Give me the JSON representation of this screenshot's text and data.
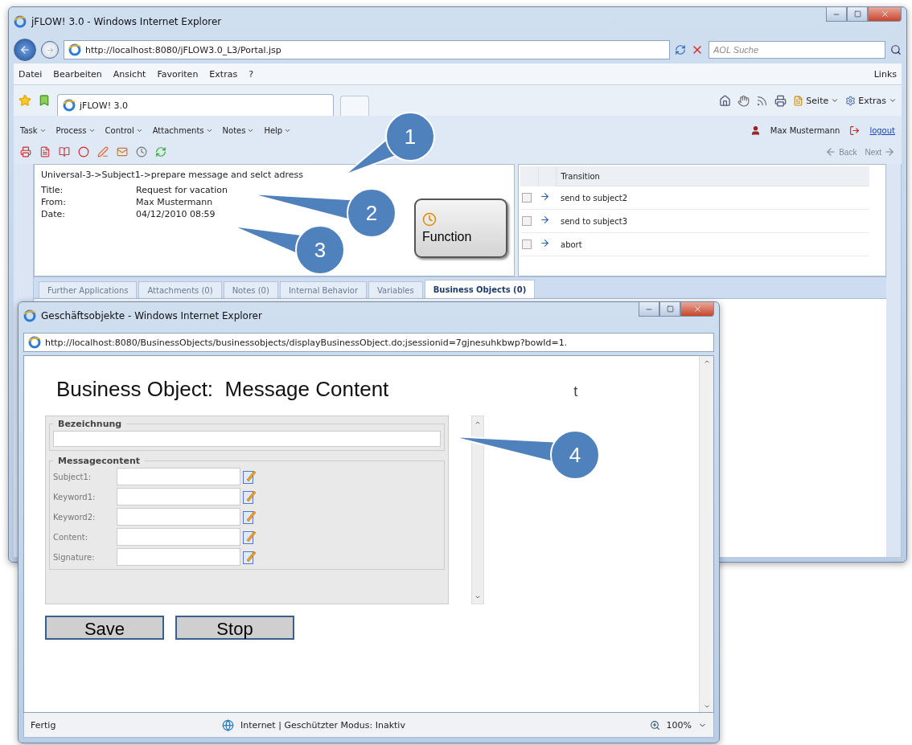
{
  "main_window": {
    "title": "jFLOW! 3.0 - Windows Internet Explorer",
    "address": "http://localhost:8080/jFLOW3.0_L3/Portal.jsp",
    "search": {
      "placeholder": "AOL Suche"
    },
    "menu": [
      "Datei",
      "Bearbeiten",
      "Ansicht",
      "Favoriten",
      "Extras",
      "?"
    ],
    "links": "Links",
    "tab": "jFLOW! 3.0",
    "command_bar": [
      "Seite",
      "Extras"
    ]
  },
  "app": {
    "menu": [
      "Task",
      "Process",
      "Control",
      "Attachments",
      "Notes",
      "Help"
    ],
    "user": "Max Mustermann",
    "logout": "logout",
    "nav": [
      {
        "label": "Back",
        "disabled": true
      },
      {
        "label": "Next",
        "disabled": true
      }
    ],
    "path": "Universal-3->Subject1->prepare message and selct adress",
    "fields": [
      {
        "label": "Title:",
        "value": "Request for vacation"
      },
      {
        "label": "From:",
        "value": "Max Mustermann"
      },
      {
        "label": "Date:",
        "value": "04/12/2010 08:59"
      }
    ],
    "function_button": "Function",
    "transition_table": {
      "columns": [
        "Transition"
      ],
      "rows": [
        {
          "label": "send to subject2",
          "checked": false
        },
        {
          "label": "send to subject3",
          "checked": false
        },
        {
          "label": "abort",
          "checked": false
        }
      ]
    },
    "tabs": [
      {
        "label": "Further Applications",
        "selected": false
      },
      {
        "label": "Attachments (0)",
        "selected": false
      },
      {
        "label": "Notes (0)",
        "selected": false
      },
      {
        "label": "Internal Behavior",
        "selected": false
      },
      {
        "label": "Variables",
        "selected": false
      },
      {
        "label": "Business Objects (0)",
        "selected": true
      }
    ]
  },
  "popup": {
    "title": "Geschäftsobjekte - Windows Internet Explorer",
    "address": "http://localhost:8080/BusinessObjects/businessobjects/displayBusinessObject.do;jsessionid=7gjnesuhkbwp?bowId=1.",
    "heading": "Business Object:  Message Content",
    "stray_text": "t",
    "name_fieldset": {
      "legend": "Bezeichnung"
    },
    "content_fieldset": {
      "legend": "Messagecontent",
      "rows": [
        "Subject1:",
        "Keyword1:",
        "Keyword2:",
        "Content:",
        "Signature:"
      ]
    },
    "buttons": [
      "Save",
      "Stop"
    ],
    "status": {
      "text": "Fertig",
      "zone": "Internet | Geschützter Modus: Inaktiv",
      "zoom": "100%"
    }
  },
  "callouts": [
    "1",
    "2",
    "3",
    "4"
  ]
}
